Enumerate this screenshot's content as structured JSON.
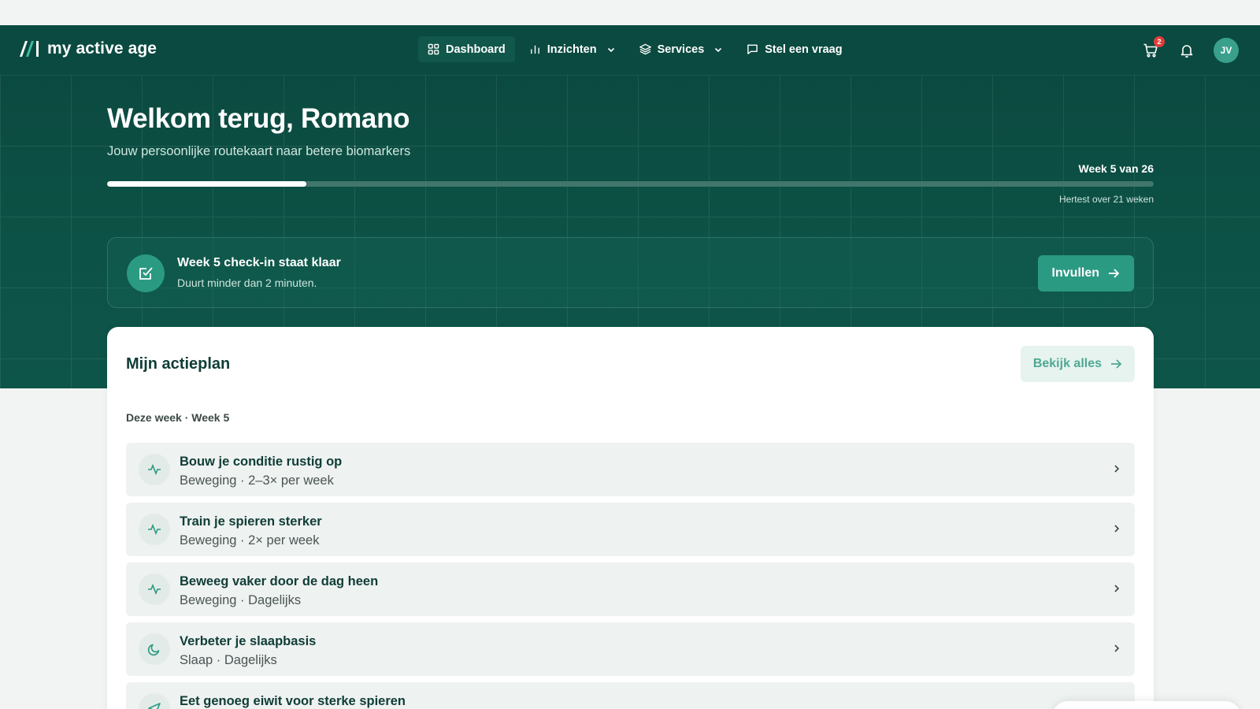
{
  "brand": {
    "name": "my active age"
  },
  "nav": {
    "items": [
      {
        "label": "Dashboard",
        "icon": "grid-icon",
        "active": true
      },
      {
        "label": "Inzichten",
        "icon": "bar-chart-icon",
        "dropdown": true
      },
      {
        "label": "Services",
        "icon": "layers-icon",
        "dropdown": true
      },
      {
        "label": "Stel een vraag",
        "icon": "message-icon"
      }
    ],
    "cart_count": "2",
    "avatar_initials": "JV"
  },
  "hero": {
    "title": "Welkom terug, Romano",
    "subtitle": "Jouw persoonlijke routekaart naar betere biomarkers",
    "week_label": "Week 5 van 26",
    "progress_fraction": 0.19,
    "retest": "Hertest over 21 weken"
  },
  "checkin": {
    "title": "Week 5 check-in staat klaar",
    "subtitle": "Duurt minder dan 2 minuten.",
    "button": "Invullen"
  },
  "actionplan": {
    "title": "Mijn actieplan",
    "view_all": "Bekijk alles",
    "section": "Deze week · Week 5",
    "items": [
      {
        "title": "Bouw je conditie rustig op",
        "sub": "Beweging · 2–3× per week",
        "icon": "activity-icon"
      },
      {
        "title": "Train je spieren sterker",
        "sub": "Beweging · 2× per week",
        "icon": "activity-icon"
      },
      {
        "title": "Beweeg vaker door de dag heen",
        "sub": "Beweging · Dagelijks",
        "icon": "activity-icon"
      },
      {
        "title": "Verbeter je slaapbasis",
        "sub": "Slaap · Dagelijks",
        "icon": "moon-icon"
      },
      {
        "title": "Eet genoeg eiwit voor sterke spieren",
        "sub": "",
        "icon": "send-icon"
      }
    ]
  },
  "colors": {
    "header_bg": "#0a4a40",
    "hero_bg": "#0d5246",
    "accent": "#2b9a82",
    "badge": "#e23b3b"
  }
}
